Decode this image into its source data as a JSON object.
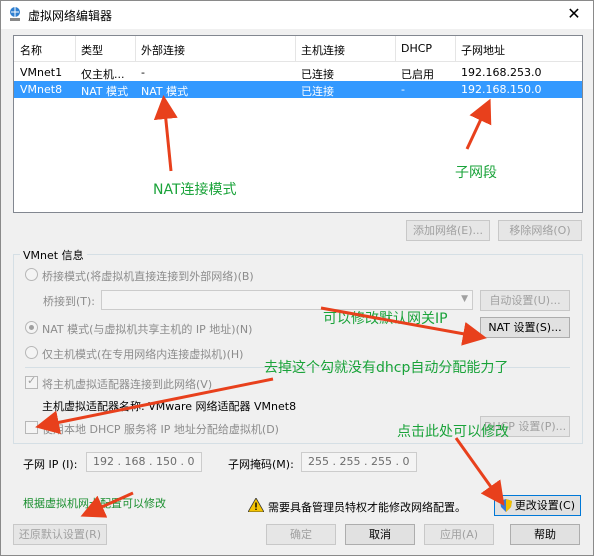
{
  "window": {
    "title": "虚拟网络编辑器",
    "close": "✕"
  },
  "table": {
    "headers": [
      "名称",
      "类型",
      "外部连接",
      "主机连接",
      "DHCP",
      "子网地址"
    ],
    "rows": [
      {
        "name": "VMnet1",
        "type": "仅主机...",
        "external": "-",
        "host": "已连接",
        "dhcp": "已启用",
        "subnet": "192.168.253.0",
        "selected": false
      },
      {
        "name": "VMnet8",
        "type": "NAT 模式",
        "external": "NAT 模式",
        "host": "已连接",
        "dhcp": "-",
        "subnet": "192.168.150.0",
        "selected": true
      }
    ]
  },
  "buttons": {
    "add_network": "添加网络(E)...",
    "remove_network": "移除网络(O)",
    "auto_settings": "自动设置(U)...",
    "nat_settings": "NAT 设置(S)...",
    "dhcp_settings": "DHCP 设置(P)...",
    "change_settings": "更改设置(C)",
    "restore_defaults": "还原默认设置(R)",
    "ok": "确定",
    "cancel": "取消",
    "apply": "应用(A)",
    "help": "帮助"
  },
  "vmnet_info": {
    "group_label": "VMnet 信息",
    "bridge_mode": "桥接模式(将虚拟机直接连接到外部网络)(B)",
    "bridge_to": "桥接到(T):",
    "nat_mode": "NAT 模式(与虚拟机共享主机的 IP 地址)(N)",
    "host_only": "仅主机模式(在专用网络内连接虚拟机)(H)",
    "connect_adapter": "将主机虚拟适配器连接到此网络(V)",
    "adapter_name": "主机虚拟适配器名称: VMware 网络适配器 VMnet8",
    "use_dhcp": "使用本地 DHCP 服务将 IP 地址分配给虚拟机(D)",
    "subnet_ip_label": "子网 IP (I):",
    "subnet_ip": "192 . 168 . 150 .  0",
    "subnet_mask_label": "子网掩码(M):",
    "subnet_mask": "255 . 255 . 255 .  0"
  },
  "admin_notice": "需要具备管理员特权才能修改网络配置。",
  "annotations": {
    "nat_mode": "NAT连接模式",
    "subnet": "子网段",
    "gateway": "可以修改默认网关IP",
    "dhcp": "去掉这个勾就没有dhcp自动分配能力了",
    "click_here": "点击此处可以修改",
    "modify_by_card": "根据虚拟机网卡配置可以修改"
  },
  "colors": {
    "selection": "#3399ff",
    "annotation": "#1aa33a",
    "arrow": "#e8401c"
  }
}
